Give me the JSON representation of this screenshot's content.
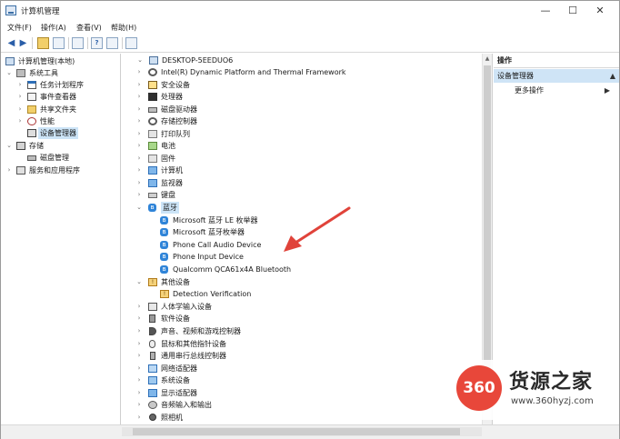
{
  "window": {
    "title": "计算机管理",
    "buttons": {
      "minimize": "—",
      "maximize": "☐",
      "close": "✕"
    }
  },
  "menu": [
    "文件(F)",
    "操作(A)",
    "查看(V)",
    "帮助(H)"
  ],
  "left_tree": {
    "root": "计算机管理(本地)",
    "system_tools": "系统工具",
    "task_scheduler": "任务计划程序",
    "event_viewer": "事件查看器",
    "shared_folders": "共享文件夹",
    "performance": "性能",
    "device_manager": "设备管理器",
    "storage": "存储",
    "disk_management": "磁盘管理",
    "services_apps": "服务和应用程序"
  },
  "device_tree": {
    "computer": "DESKTOP-5EEDUO6",
    "categories": [
      {
        "label": "Intel(R) Dynamic Platform and Thermal Framework",
        "icon": "gear-icon"
      },
      {
        "label": "安全设备",
        "icon": "security-device-icon"
      },
      {
        "label": "处理器",
        "icon": "processor-icon"
      },
      {
        "label": "磁盘驱动器",
        "icon": "disk-drive-icon"
      },
      {
        "label": "存储控制器",
        "icon": "storage-controller-icon"
      },
      {
        "label": "打印队列",
        "icon": "printer-icon"
      },
      {
        "label": "电池",
        "icon": "battery-icon"
      },
      {
        "label": "固件",
        "icon": "firmware-icon"
      },
      {
        "label": "计算机",
        "icon": "computer-icon"
      },
      {
        "label": "监视器",
        "icon": "monitor-icon"
      },
      {
        "label": "键盘",
        "icon": "keyboard-icon"
      }
    ],
    "bluetooth": {
      "label": "蓝牙",
      "devices": [
        "Microsoft 蓝牙 LE 枚举器",
        "Microsoft 蓝牙枚举器",
        "Phone Call Audio Device",
        "Phone Input Device",
        "Qualcomm QCA61x4A Bluetooth"
      ]
    },
    "other": {
      "label": "其他设备",
      "devices": [
        "Detection Verification"
      ]
    },
    "more_categories": [
      {
        "label": "人体学输入设备",
        "icon": "hid-icon"
      },
      {
        "label": "软件设备",
        "icon": "software-device-icon"
      },
      {
        "label": "声音、视频和游戏控制器",
        "icon": "sound-icon"
      },
      {
        "label": "鼠标和其他指针设备",
        "icon": "mouse-icon"
      },
      {
        "label": "通用串行总线控制器",
        "icon": "usb-icon"
      },
      {
        "label": "网络适配器",
        "icon": "network-adapter-icon"
      },
      {
        "label": "系统设备",
        "icon": "system-device-icon"
      },
      {
        "label": "显示适配器",
        "icon": "display-adapter-icon"
      },
      {
        "label": "音频输入和输出",
        "icon": "audio-io-icon"
      },
      {
        "label": "照相机",
        "icon": "camera-icon"
      }
    ]
  },
  "actions_pane": {
    "header": "操作",
    "section": "设备管理器",
    "more": "更多操作"
  },
  "watermark": {
    "logo": "360",
    "brand": "货源之家",
    "url": "www.360hyzj.com"
  },
  "colors": {
    "selection": "#cce4f7",
    "arrow": "#e0433a",
    "bluetooth": "#2f84d8"
  }
}
